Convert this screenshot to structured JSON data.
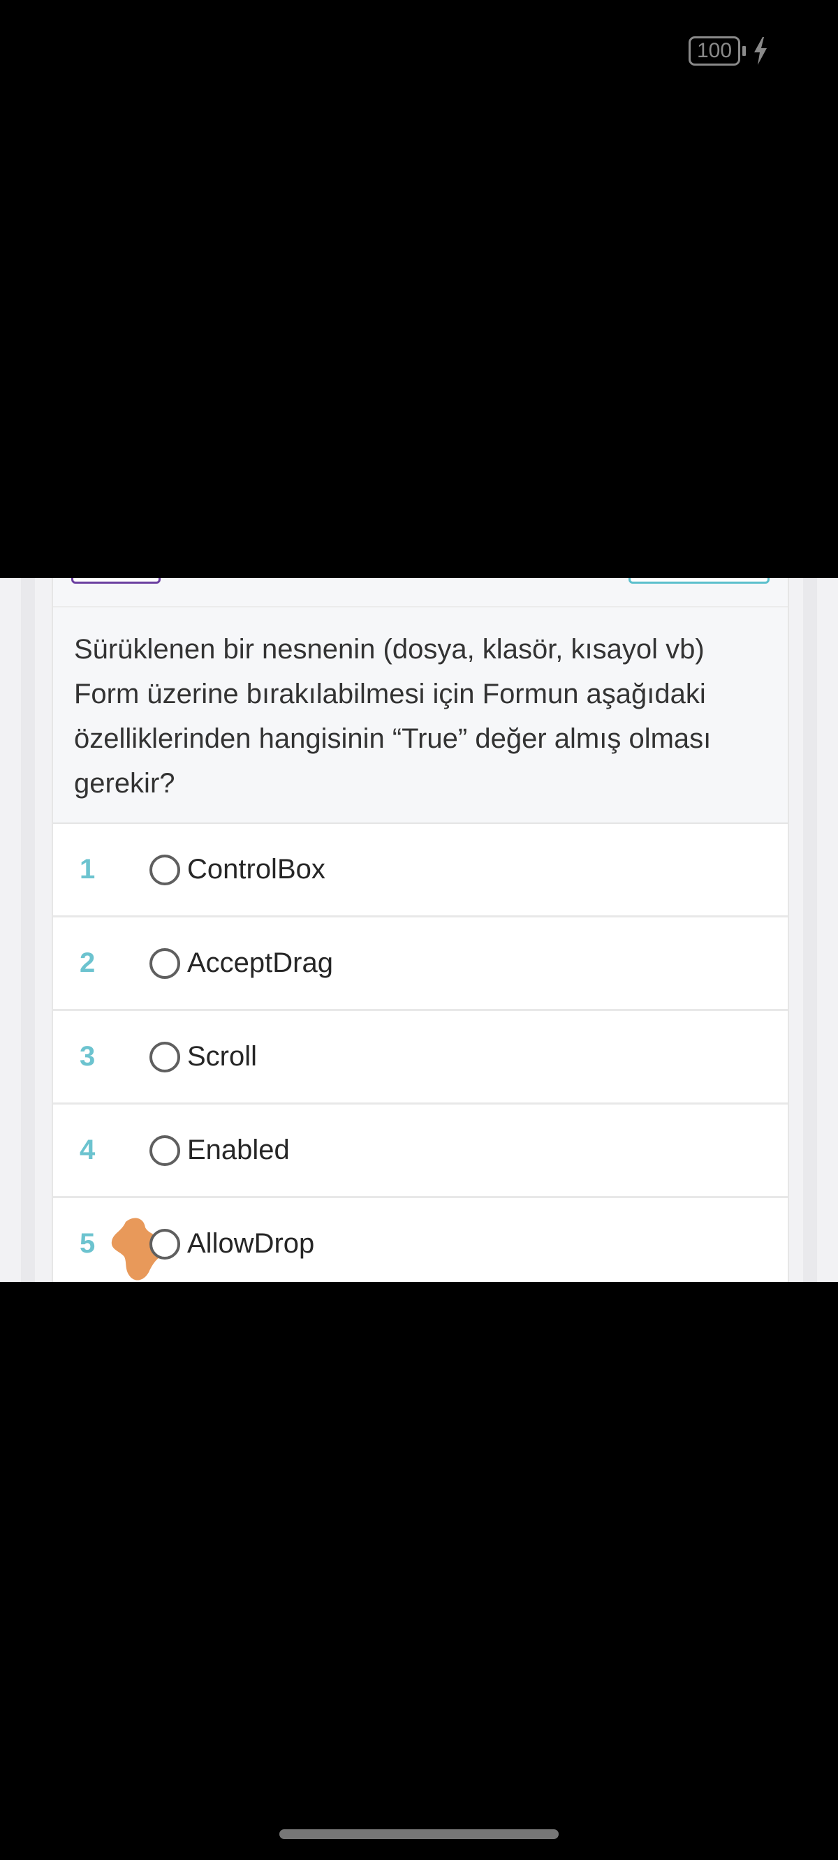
{
  "status_bar": {
    "battery_level": "100",
    "battery_icon": "battery-icon",
    "charging_icon": "lightning-bolt-icon"
  },
  "question": {
    "text": "Sürüklenen bir nesnenin (dosya, klasör, kısayol vb) Form üzerine bırakılabilmesi için Formun aşağıdaki özelliklerinden hangisinin “True” değer almış olması gerekir?"
  },
  "options": [
    {
      "number": "1",
      "label": "ControlBox",
      "selected": false
    },
    {
      "number": "2",
      "label": "AcceptDrag",
      "selected": false
    },
    {
      "number": "3",
      "label": "Scroll",
      "selected": false
    },
    {
      "number": "4",
      "label": "Enabled",
      "selected": false
    },
    {
      "number": "5",
      "label": "AllowDrop",
      "selected": false
    }
  ],
  "colors": {
    "option_number": "#6cc3cf",
    "left_button_border": "#6b3fa0",
    "right_button_border": "#5bbfcc",
    "annotation_mark": "#e8995a"
  }
}
